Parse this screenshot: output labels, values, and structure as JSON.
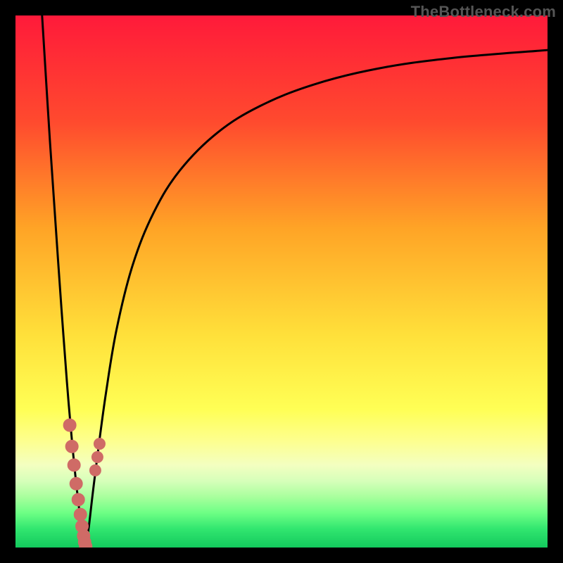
{
  "watermark": "TheBottleneck.com",
  "colors": {
    "frame": "#000000",
    "gradient_stops": [
      {
        "offset": 0.0,
        "color": "#ff1a3a"
      },
      {
        "offset": 0.2,
        "color": "#ff4a2e"
      },
      {
        "offset": 0.4,
        "color": "#ffa426"
      },
      {
        "offset": 0.6,
        "color": "#ffe03a"
      },
      {
        "offset": 0.74,
        "color": "#ffff55"
      },
      {
        "offset": 0.8,
        "color": "#fdff8f"
      },
      {
        "offset": 0.845,
        "color": "#f3ffc0"
      },
      {
        "offset": 0.875,
        "color": "#d6ffba"
      },
      {
        "offset": 0.905,
        "color": "#a8ff9d"
      },
      {
        "offset": 0.935,
        "color": "#6dff85"
      },
      {
        "offset": 0.965,
        "color": "#31e66f"
      },
      {
        "offset": 1.0,
        "color": "#13c95d"
      }
    ],
    "curve_stroke": "#000000",
    "marker_fill": "#cf6b66",
    "marker_stroke": "#cf6b66"
  },
  "chart_data": {
    "type": "line",
    "title": "",
    "xlabel": "",
    "ylabel": "",
    "xlim": [
      0,
      100
    ],
    "ylim": [
      0,
      100
    ],
    "note": "V-shaped bottleneck curve with minimum near x≈13; no visible axis tick labels",
    "series": [
      {
        "name": "curve-left",
        "x": [
          5.0,
          6.5,
          8.0,
          9.0,
          10.0,
          11.0,
          12.0,
          12.8,
          13.2
        ],
        "y": [
          100,
          76,
          54,
          40,
          27,
          16,
          7,
          1.5,
          0
        ]
      },
      {
        "name": "curve-right",
        "x": [
          13.2,
          13.8,
          14.5,
          15.5,
          17.0,
          19.0,
          22.0,
          26.0,
          31.0,
          38.0,
          46.0,
          56.0,
          68.0,
          82.0,
          100.0
        ],
        "y": [
          0,
          4,
          10,
          18,
          29,
          41,
          53,
          63,
          71,
          78,
          83,
          87,
          90,
          92,
          93.5
        ]
      }
    ],
    "markers_left": {
      "name": "highlight-left",
      "x": [
        10.2,
        10.6,
        11.0,
        11.4,
        11.8,
        12.2,
        12.5,
        12.8,
        13.0,
        13.2
      ],
      "y": [
        23,
        19,
        15.5,
        12,
        9,
        6.2,
        4.0,
        2.2,
        1.0,
        0.2
      ]
    },
    "markers_right": {
      "name": "highlight-right",
      "x": [
        15.0,
        15.4,
        15.8
      ],
      "y": [
        14.5,
        17.0,
        19.5
      ]
    }
  }
}
